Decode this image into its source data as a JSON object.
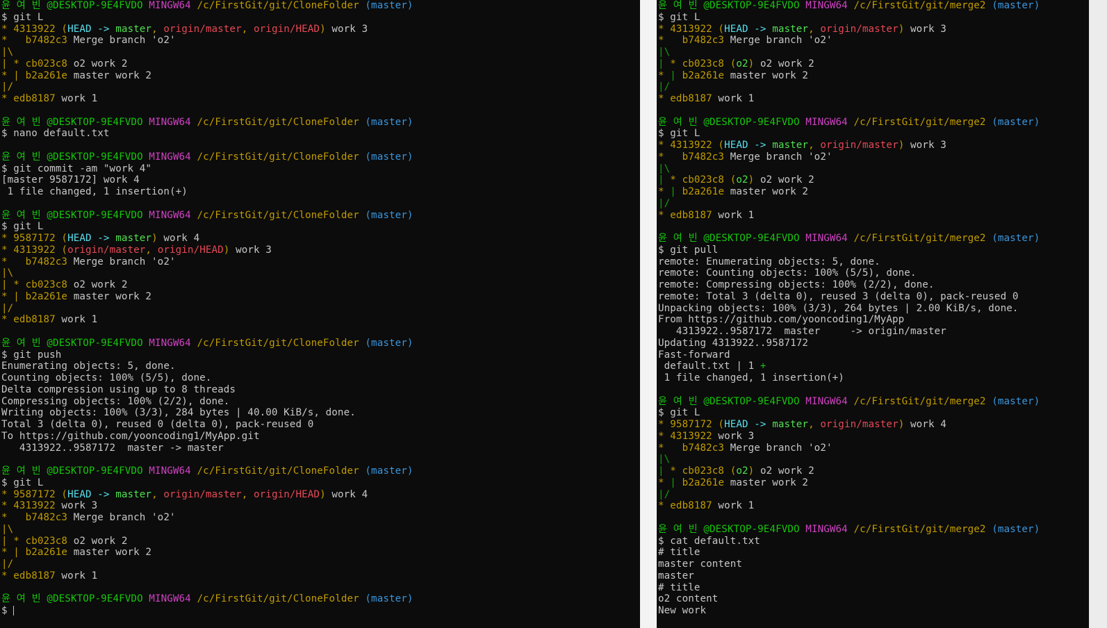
{
  "colors": {
    "default": "#c8c8c8",
    "user_host": "#16c60c",
    "msystem": "#d041c4",
    "path": "#c19c00",
    "branch_prompt": "#3a96dd",
    "head": "#55e0ef",
    "remote_ref": "#e74856",
    "local_ref": "#4fe04f",
    "graph": "#c19c00",
    "background": "#0c0c0c"
  },
  "left_terminal": [
    [
      [
        "green",
        "윤 여 빈 @DESKTOP-9E4FVDO "
      ],
      [
        "pink",
        "MINGW64 "
      ],
      [
        "olive",
        "/c/FirstGit/git/CloneFolder "
      ],
      [
        "cyan",
        "(master)"
      ]
    ],
    [
      [
        "def",
        "$ git L"
      ]
    ],
    [
      [
        "olive",
        "* 4313922 "
      ],
      [
        "olive",
        "("
      ],
      [
        "bcyan",
        "HEAD -> "
      ],
      [
        "bgreen",
        "master"
      ],
      [
        "olive",
        ", "
      ],
      [
        "red",
        "origin/master"
      ],
      [
        "olive",
        ", "
      ],
      [
        "red",
        "origin/HEAD"
      ],
      [
        "olive",
        ")"
      ],
      [
        "def",
        " work 3"
      ]
    ],
    [
      [
        "olive",
        "*   b7482c3"
      ],
      [
        "def",
        " Merge branch 'o2'"
      ]
    ],
    [
      [
        "olive",
        "|\\"
      ]
    ],
    [
      [
        "olive",
        "| * cb023c8"
      ],
      [
        "def",
        " o2 work 2"
      ]
    ],
    [
      [
        "olive",
        "* | b2a261e"
      ],
      [
        "def",
        " master work 2"
      ]
    ],
    [
      [
        "olive",
        "|/"
      ]
    ],
    [
      [
        "olive",
        "* edb8187"
      ],
      [
        "def",
        " work 1"
      ]
    ],
    [
      [
        "def",
        ""
      ]
    ],
    [
      [
        "green",
        "윤 여 빈 @DESKTOP-9E4FVDO "
      ],
      [
        "pink",
        "MINGW64 "
      ],
      [
        "olive",
        "/c/FirstGit/git/CloneFolder "
      ],
      [
        "cyan",
        "(master)"
      ]
    ],
    [
      [
        "def",
        "$ nano default.txt"
      ]
    ],
    [
      [
        "def",
        ""
      ]
    ],
    [
      [
        "green",
        "윤 여 빈 @DESKTOP-9E4FVDO "
      ],
      [
        "pink",
        "MINGW64 "
      ],
      [
        "olive",
        "/c/FirstGit/git/CloneFolder "
      ],
      [
        "cyan",
        "(master)"
      ]
    ],
    [
      [
        "def",
        "$ git commit -am \"work 4\""
      ]
    ],
    [
      [
        "def",
        "[master 9587172] work 4"
      ]
    ],
    [
      [
        "def",
        " 1 file changed, 1 insertion(+)"
      ]
    ],
    [
      [
        "def",
        ""
      ]
    ],
    [
      [
        "green",
        "윤 여 빈 @DESKTOP-9E4FVDO "
      ],
      [
        "pink",
        "MINGW64 "
      ],
      [
        "olive",
        "/c/FirstGit/git/CloneFolder "
      ],
      [
        "cyan",
        "(master)"
      ]
    ],
    [
      [
        "def",
        "$ git L"
      ]
    ],
    [
      [
        "olive",
        "* 9587172 "
      ],
      [
        "olive",
        "("
      ],
      [
        "bcyan",
        "HEAD -> "
      ],
      [
        "bgreen",
        "master"
      ],
      [
        "olive",
        ")"
      ],
      [
        "def",
        " work 4"
      ]
    ],
    [
      [
        "olive",
        "* 4313922 "
      ],
      [
        "olive",
        "("
      ],
      [
        "red",
        "origin/master"
      ],
      [
        "olive",
        ", "
      ],
      [
        "red",
        "origin/HEAD"
      ],
      [
        "olive",
        ")"
      ],
      [
        "def",
        " work 3"
      ]
    ],
    [
      [
        "olive",
        "*   b7482c3"
      ],
      [
        "def",
        " Merge branch 'o2'"
      ]
    ],
    [
      [
        "olive",
        "|\\"
      ]
    ],
    [
      [
        "olive",
        "| * cb023c8"
      ],
      [
        "def",
        " o2 work 2"
      ]
    ],
    [
      [
        "olive",
        "* | b2a261e"
      ],
      [
        "def",
        " master work 2"
      ]
    ],
    [
      [
        "olive",
        "|/"
      ]
    ],
    [
      [
        "olive",
        "* edb8187"
      ],
      [
        "def",
        " work 1"
      ]
    ],
    [
      [
        "def",
        ""
      ]
    ],
    [
      [
        "green",
        "윤 여 빈 @DESKTOP-9E4FVDO "
      ],
      [
        "pink",
        "MINGW64 "
      ],
      [
        "olive",
        "/c/FirstGit/git/CloneFolder "
      ],
      [
        "cyan",
        "(master)"
      ]
    ],
    [
      [
        "def",
        "$ git push"
      ]
    ],
    [
      [
        "def",
        "Enumerating objects: 5, done."
      ]
    ],
    [
      [
        "def",
        "Counting objects: 100% (5/5), done."
      ]
    ],
    [
      [
        "def",
        "Delta compression using up to 8 threads"
      ]
    ],
    [
      [
        "def",
        "Compressing objects: 100% (2/2), done."
      ]
    ],
    [
      [
        "def",
        "Writing objects: 100% (3/3), 284 bytes | 40.00 KiB/s, done."
      ]
    ],
    [
      [
        "def",
        "Total 3 (delta 0), reused 0 (delta 0), pack-reused 0"
      ]
    ],
    [
      [
        "def",
        "To https://github.com/yooncoding1/MyApp.git"
      ]
    ],
    [
      [
        "def",
        "   4313922..9587172  master -> master"
      ]
    ],
    [
      [
        "def",
        ""
      ]
    ],
    [
      [
        "green",
        "윤 여 빈 @DESKTOP-9E4FVDO "
      ],
      [
        "pink",
        "MINGW64 "
      ],
      [
        "olive",
        "/c/FirstGit/git/CloneFolder "
      ],
      [
        "cyan",
        "(master)"
      ]
    ],
    [
      [
        "def",
        "$ git L"
      ]
    ],
    [
      [
        "olive",
        "* 9587172 "
      ],
      [
        "olive",
        "("
      ],
      [
        "bcyan",
        "HEAD -> "
      ],
      [
        "bgreen",
        "master"
      ],
      [
        "olive",
        ", "
      ],
      [
        "red",
        "origin/master"
      ],
      [
        "olive",
        ", "
      ],
      [
        "red",
        "origin/HEAD"
      ],
      [
        "olive",
        ")"
      ],
      [
        "def",
        " work 4"
      ]
    ],
    [
      [
        "olive",
        "* 4313922"
      ],
      [
        "def",
        " work 3"
      ]
    ],
    [
      [
        "olive",
        "*   b7482c3"
      ],
      [
        "def",
        " Merge branch 'o2'"
      ]
    ],
    [
      [
        "olive",
        "|\\"
      ]
    ],
    [
      [
        "olive",
        "| * cb023c8"
      ],
      [
        "def",
        " o2 work 2"
      ]
    ],
    [
      [
        "olive",
        "* | b2a261e"
      ],
      [
        "def",
        " master work 2"
      ]
    ],
    [
      [
        "olive",
        "|/"
      ]
    ],
    [
      [
        "olive",
        "* edb8187"
      ],
      [
        "def",
        " work 1"
      ]
    ],
    [
      [
        "def",
        ""
      ]
    ],
    [
      [
        "green",
        "윤 여 빈 @DESKTOP-9E4FVDO "
      ],
      [
        "pink",
        "MINGW64 "
      ],
      [
        "olive",
        "/c/FirstGit/git/CloneFolder "
      ],
      [
        "cyan",
        "(master)"
      ]
    ],
    [
      [
        "def",
        "$ "
      ],
      [
        "cursor",
        ""
      ]
    ]
  ],
  "right_terminal": [
    [
      [
        "green",
        "윤 여 빈 @DESKTOP-9E4FVDO "
      ],
      [
        "pink",
        "MINGW64 "
      ],
      [
        "olive",
        "/c/FirstGit/git/merge2 "
      ],
      [
        "cyan",
        "(master)"
      ]
    ],
    [
      [
        "def",
        "$ git L"
      ]
    ],
    [
      [
        "olive",
        "* 4313922 "
      ],
      [
        "olive",
        "("
      ],
      [
        "bcyan",
        "HEAD -> "
      ],
      [
        "bgreen",
        "master"
      ],
      [
        "olive",
        ", "
      ],
      [
        "red",
        "origin/master"
      ],
      [
        "olive",
        ")"
      ],
      [
        "def",
        " work 3"
      ]
    ],
    [
      [
        "olive",
        "*   b7482c3"
      ],
      [
        "def",
        " Merge branch 'o2'"
      ]
    ],
    [
      [
        "dgreen",
        "|\\"
      ]
    ],
    [
      [
        "dgreen",
        "| "
      ],
      [
        "olive",
        "* cb023c8 "
      ],
      [
        "olive",
        "("
      ],
      [
        "bgreen",
        "o2"
      ],
      [
        "olive",
        ")"
      ],
      [
        "def",
        " o2 work 2"
      ]
    ],
    [
      [
        "olive",
        "* "
      ],
      [
        "dgreen",
        "| "
      ],
      [
        "olive",
        "b2a261e"
      ],
      [
        "def",
        " master work 2"
      ]
    ],
    [
      [
        "dgreen",
        "|/"
      ]
    ],
    [
      [
        "olive",
        "* edb8187"
      ],
      [
        "def",
        " work 1"
      ]
    ],
    [
      [
        "def",
        ""
      ]
    ],
    [
      [
        "green",
        "윤 여 빈 @DESKTOP-9E4FVDO "
      ],
      [
        "pink",
        "MINGW64 "
      ],
      [
        "olive",
        "/c/FirstGit/git/merge2 "
      ],
      [
        "cyan",
        "(master)"
      ]
    ],
    [
      [
        "def",
        "$ git L"
      ]
    ],
    [
      [
        "olive",
        "* 4313922 "
      ],
      [
        "olive",
        "("
      ],
      [
        "bcyan",
        "HEAD -> "
      ],
      [
        "bgreen",
        "master"
      ],
      [
        "olive",
        ", "
      ],
      [
        "red",
        "origin/master"
      ],
      [
        "olive",
        ")"
      ],
      [
        "def",
        " work 3"
      ]
    ],
    [
      [
        "olive",
        "*   b7482c3"
      ],
      [
        "def",
        " Merge branch 'o2'"
      ]
    ],
    [
      [
        "dgreen",
        "|\\"
      ]
    ],
    [
      [
        "dgreen",
        "| "
      ],
      [
        "olive",
        "* cb023c8 "
      ],
      [
        "olive",
        "("
      ],
      [
        "bgreen",
        "o2"
      ],
      [
        "olive",
        ")"
      ],
      [
        "def",
        " o2 work 2"
      ]
    ],
    [
      [
        "olive",
        "* "
      ],
      [
        "dgreen",
        "| "
      ],
      [
        "olive",
        "b2a261e"
      ],
      [
        "def",
        " master work 2"
      ]
    ],
    [
      [
        "dgreen",
        "|/"
      ]
    ],
    [
      [
        "olive",
        "* edb8187"
      ],
      [
        "def",
        " work 1"
      ]
    ],
    [
      [
        "def",
        ""
      ]
    ],
    [
      [
        "green",
        "윤 여 빈 @DESKTOP-9E4FVDO "
      ],
      [
        "pink",
        "MINGW64 "
      ],
      [
        "olive",
        "/c/FirstGit/git/merge2 "
      ],
      [
        "cyan",
        "(master)"
      ]
    ],
    [
      [
        "def",
        "$ git pull"
      ]
    ],
    [
      [
        "def",
        "remote: Enumerating objects: 5, done."
      ]
    ],
    [
      [
        "def",
        "remote: Counting objects: 100% (5/5), done."
      ]
    ],
    [
      [
        "def",
        "remote: Compressing objects: 100% (2/2), done."
      ]
    ],
    [
      [
        "def",
        "remote: Total 3 (delta 0), reused 3 (delta 0), pack-reused 0"
      ]
    ],
    [
      [
        "def",
        "Unpacking objects: 100% (3/3), 264 bytes | 2.00 KiB/s, done."
      ]
    ],
    [
      [
        "def",
        "From https://github.com/yooncoding1/MyApp"
      ]
    ],
    [
      [
        "def",
        "   4313922..9587172  master     -> origin/master"
      ]
    ],
    [
      [
        "def",
        "Updating 4313922..9587172"
      ]
    ],
    [
      [
        "def",
        "Fast-forward"
      ]
    ],
    [
      [
        "def",
        " default.txt | 1 "
      ],
      [
        "green",
        "+"
      ]
    ],
    [
      [
        "def",
        " 1 file changed, 1 insertion(+)"
      ]
    ],
    [
      [
        "def",
        ""
      ]
    ],
    [
      [
        "green",
        "윤 여 빈 @DESKTOP-9E4FVDO "
      ],
      [
        "pink",
        "MINGW64 "
      ],
      [
        "olive",
        "/c/FirstGit/git/merge2 "
      ],
      [
        "cyan",
        "(master)"
      ]
    ],
    [
      [
        "def",
        "$ git L"
      ]
    ],
    [
      [
        "olive",
        "* 9587172 "
      ],
      [
        "olive",
        "("
      ],
      [
        "bcyan",
        "HEAD -> "
      ],
      [
        "bgreen",
        "master"
      ],
      [
        "olive",
        ", "
      ],
      [
        "red",
        "origin/master"
      ],
      [
        "olive",
        ")"
      ],
      [
        "def",
        " work 4"
      ]
    ],
    [
      [
        "olive",
        "* 4313922"
      ],
      [
        "def",
        " work 3"
      ]
    ],
    [
      [
        "olive",
        "*   b7482c3"
      ],
      [
        "def",
        " Merge branch 'o2'"
      ]
    ],
    [
      [
        "dgreen",
        "|\\"
      ]
    ],
    [
      [
        "dgreen",
        "| "
      ],
      [
        "olive",
        "* cb023c8 "
      ],
      [
        "olive",
        "("
      ],
      [
        "bgreen",
        "o2"
      ],
      [
        "olive",
        ")"
      ],
      [
        "def",
        " o2 work 2"
      ]
    ],
    [
      [
        "olive",
        "* "
      ],
      [
        "dgreen",
        "| "
      ],
      [
        "olive",
        "b2a261e"
      ],
      [
        "def",
        " master work 2"
      ]
    ],
    [
      [
        "dgreen",
        "|/"
      ]
    ],
    [
      [
        "olive",
        "* edb8187"
      ],
      [
        "def",
        " work 1"
      ]
    ],
    [
      [
        "def",
        ""
      ]
    ],
    [
      [
        "green",
        "윤 여 빈 @DESKTOP-9E4FVDO "
      ],
      [
        "pink",
        "MINGW64 "
      ],
      [
        "olive",
        "/c/FirstGit/git/merge2 "
      ],
      [
        "cyan",
        "(master)"
      ]
    ],
    [
      [
        "def",
        "$ cat default.txt"
      ]
    ],
    [
      [
        "def",
        "# title"
      ]
    ],
    [
      [
        "def",
        "master content"
      ]
    ],
    [
      [
        "def",
        "master"
      ]
    ],
    [
      [
        "def",
        "# title"
      ]
    ],
    [
      [
        "def",
        "o2 content"
      ]
    ],
    [
      [
        "def",
        "New work"
      ]
    ]
  ]
}
